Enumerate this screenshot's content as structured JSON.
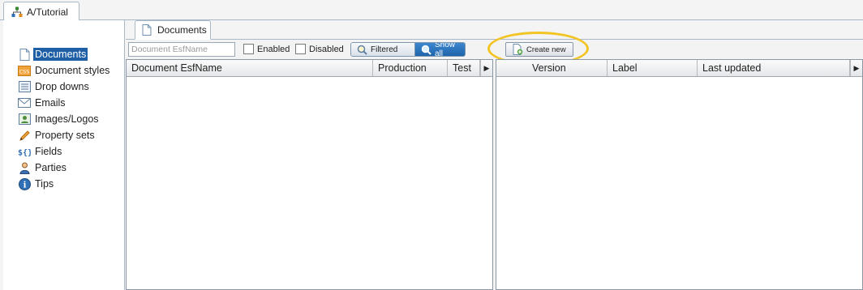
{
  "window_tab": {
    "label": "A/Tutorial",
    "icon": "sitemap-icon"
  },
  "sidebar": {
    "items": [
      {
        "label": "Documents",
        "icon": "document-icon",
        "selected": true
      },
      {
        "label": "Document styles",
        "icon": "css-icon"
      },
      {
        "label": "Drop downs",
        "icon": "list-icon"
      },
      {
        "label": "Emails",
        "icon": "envelope-icon"
      },
      {
        "label": "Images/Logos",
        "icon": "image-icon"
      },
      {
        "label": "Property sets",
        "icon": "pencil-icon"
      },
      {
        "label": "Fields",
        "icon": "braces-icon"
      },
      {
        "label": "Parties",
        "icon": "person-icon"
      },
      {
        "label": "Tips",
        "icon": "info-icon"
      }
    ]
  },
  "main_tab": {
    "label": "Documents",
    "icon": "document-icon"
  },
  "toolbar": {
    "search_placeholder": "Document EsfName",
    "enabled_label": "Enabled",
    "disabled_label": "Disabled",
    "filtered_label": "Filtered",
    "show_all_label": "Show all",
    "create_new_label": "Create new"
  },
  "left_grid": {
    "columns": [
      "Document EsfName",
      "Production",
      "Test"
    ]
  },
  "right_grid": {
    "columns": [
      "Version",
      "Label",
      "Last updated"
    ]
  },
  "colors": {
    "selected": "#1f5fa6",
    "highlight": "#f2c524",
    "toggle_active": "#2b74bd"
  }
}
